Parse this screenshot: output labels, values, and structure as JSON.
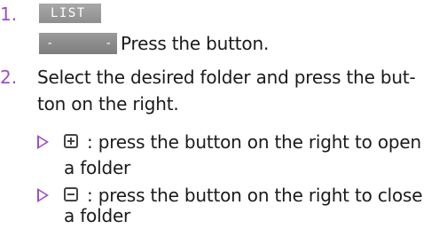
{
  "steps": [
    {
      "number": "1.",
      "list_button_label": "LIST",
      "bar_button_left_label": "-",
      "bar_button_right_label": "-",
      "text": "Press the button."
    },
    {
      "number": "2.",
      "text_line1": "Select the desired folder and press the but-",
      "text_line2": "ton on the right."
    }
  ],
  "bullets": [
    {
      "icon": "plus-box-icon",
      "line1": ": press the button on the right to open",
      "line2": "a folder"
    },
    {
      "icon": "minus-box-icon",
      "line1": ": press the button on the right to close",
      "line2": "a folder"
    }
  ],
  "colors": {
    "step_number": "#9b4fc6",
    "bullet_triangle": "#9b4fc6",
    "button_gray": "#8e8e8e"
  }
}
